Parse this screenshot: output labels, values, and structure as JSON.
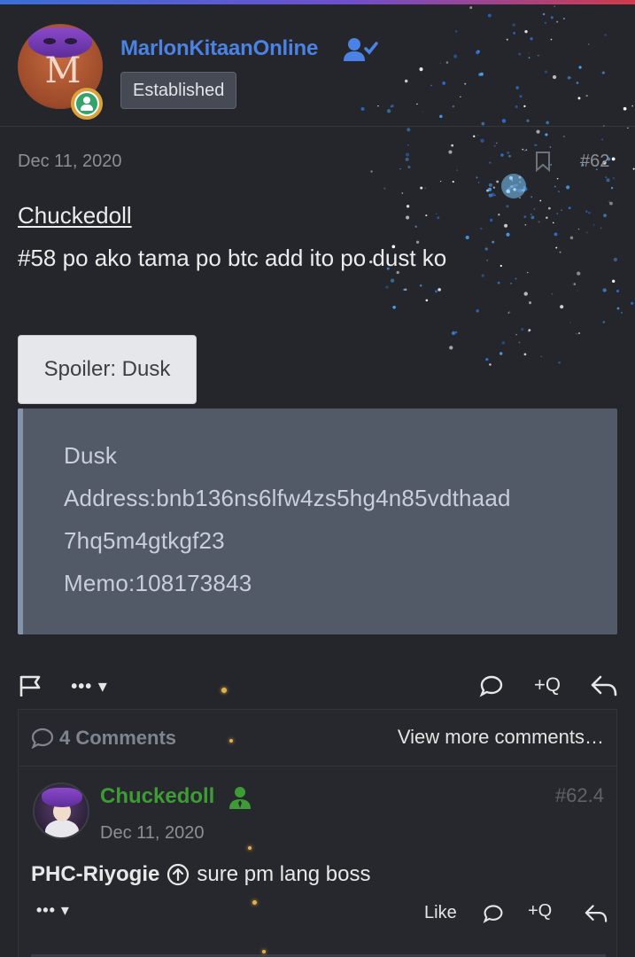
{
  "post": {
    "author": {
      "name": "MarlonKitaanOnline",
      "title": "Established",
      "avatar_letters": "M",
      "badge_icon": "user-check-icon",
      "online_icon": "online-status-icon"
    },
    "date": "Dec 11, 2020",
    "number": "#62",
    "mention": "Chuckedoll",
    "text": "#58 po ako tama po btc add ito po dust ko",
    "spoiler": {
      "button_label": "Spoiler: Dusk",
      "lines": [
        "Dusk",
        "Address:bnb136ns6lfw4zs5hg4n85vdthaad",
        "7hq5m4gtkgf23",
        "Memo:108173843"
      ]
    },
    "actions": {
      "more_label": "••• ▾",
      "quote_label": "+Q"
    }
  },
  "comments": {
    "count_label": "4 Comments",
    "view_more_label": "View more comments…",
    "items": [
      {
        "user": "Chuckedoll",
        "number": "#62.4",
        "date": "Dec 11, 2020",
        "mention_user": "PHC-Riyogie",
        "text": "sure pm lang boss",
        "more_label": "••• ▾",
        "like_label": "Like",
        "quote_label": "+Q"
      }
    ]
  },
  "colors": {
    "username": "#4b82e6",
    "comment_user": "#3d9c34",
    "background": "#25262b",
    "spoiler_box": "#525a68"
  }
}
